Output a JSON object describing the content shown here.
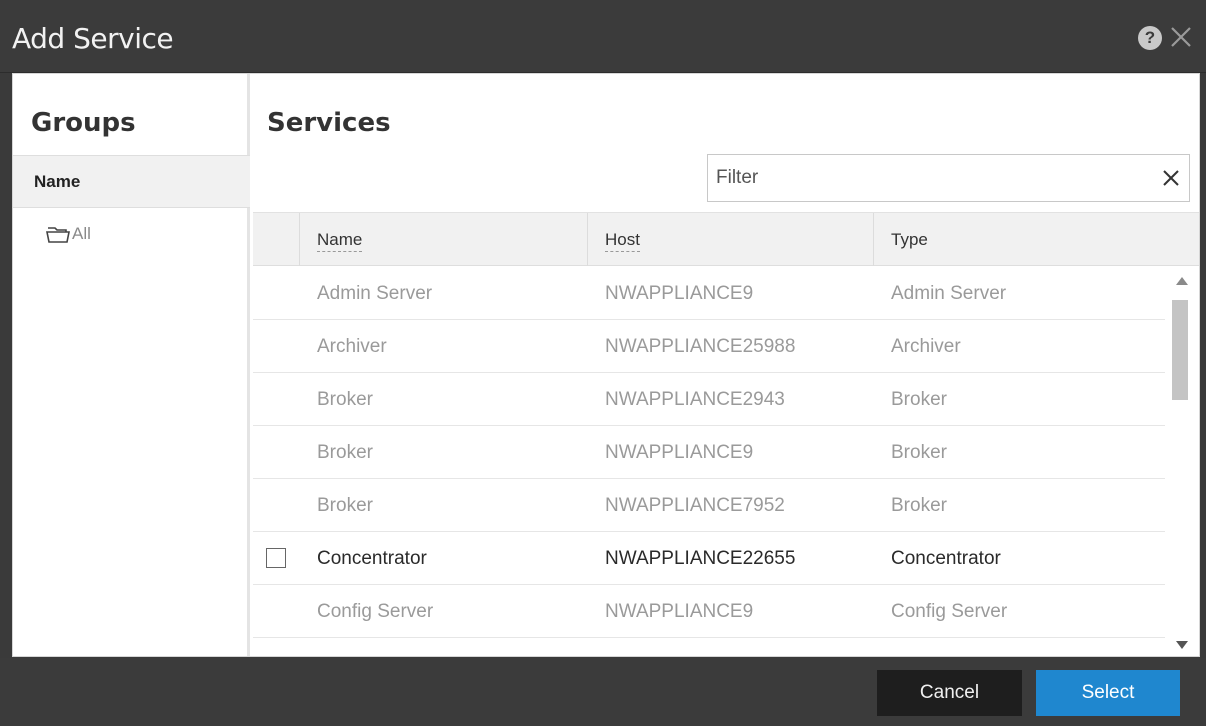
{
  "dialog": {
    "title": "Add Service"
  },
  "groups": {
    "heading": "Groups",
    "column_header": "Name",
    "items": [
      {
        "label": "All",
        "icon": "folder-icon"
      }
    ]
  },
  "services": {
    "heading": "Services",
    "filter": {
      "placeholder": "Filter",
      "value": ""
    },
    "columns": {
      "name": "Name",
      "host": "Host",
      "type": "Type"
    },
    "rows": [
      {
        "name": "Admin Server",
        "host": "NWAPPLIANCE9",
        "type": "Admin Server",
        "selectable": false
      },
      {
        "name": "Archiver",
        "host": "NWAPPLIANCE25988",
        "type": "Archiver",
        "selectable": false
      },
      {
        "name": "Broker",
        "host": "NWAPPLIANCE2943",
        "type": "Broker",
        "selectable": false
      },
      {
        "name": "Broker",
        "host": "NWAPPLIANCE9",
        "type": "Broker",
        "selectable": false
      },
      {
        "name": "Broker",
        "host": "NWAPPLIANCE7952",
        "type": "Broker",
        "selectable": false
      },
      {
        "name": "Concentrator",
        "host": "NWAPPLIANCE22655",
        "type": "Concentrator",
        "selectable": true,
        "checked": false
      },
      {
        "name": "Config Server",
        "host": "NWAPPLIANCE9",
        "type": "Config Server",
        "selectable": false
      }
    ]
  },
  "footer": {
    "cancel_label": "Cancel",
    "select_label": "Select"
  },
  "colors": {
    "titlebar": "#3b3b3b",
    "primary_button": "#1f87cf",
    "secondary_button": "#1e1e1e",
    "disabled_text": "#9a9a9a"
  }
}
